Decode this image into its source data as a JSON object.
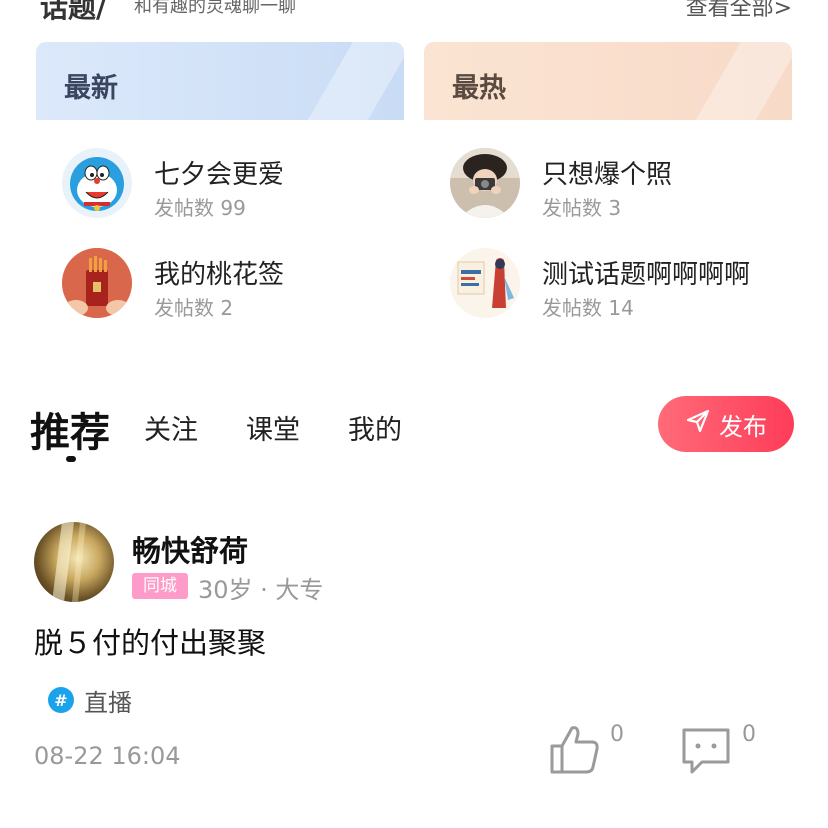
{
  "topic_section": {
    "title": "话题/",
    "subtitle": "和有趣的灵魂聊一聊",
    "view_all": "查看全部>"
  },
  "panels": {
    "latest": {
      "title": "最新",
      "items": [
        {
          "name": "七夕会更爱",
          "count": "发帖数 99"
        },
        {
          "name": "我的桃花签",
          "count": "发帖数 2"
        }
      ]
    },
    "hottest": {
      "title": "最热",
      "items": [
        {
          "name": "只想爆个照",
          "count": "发帖数 3"
        },
        {
          "name": "测试话题啊啊啊啊",
          "count": "发帖数 14"
        }
      ]
    }
  },
  "tabs": {
    "recommend": "推荐",
    "follow": "关注",
    "classroom": "课堂",
    "mine": "我的"
  },
  "publish_button": {
    "label": "发布",
    "icon": "send-icon"
  },
  "post": {
    "user_name": "畅快舒荷",
    "badge": "同城",
    "meta": "30岁 · 大专",
    "content": "脱５付的付出聚聚",
    "tag": "直播",
    "time": "08-22 16:04",
    "likes": "0",
    "comments": "0"
  },
  "colors": {
    "accent": "#fe3c5a",
    "badge_pink": "#ff9bc8",
    "tag_blue": "#1aa3ea"
  }
}
